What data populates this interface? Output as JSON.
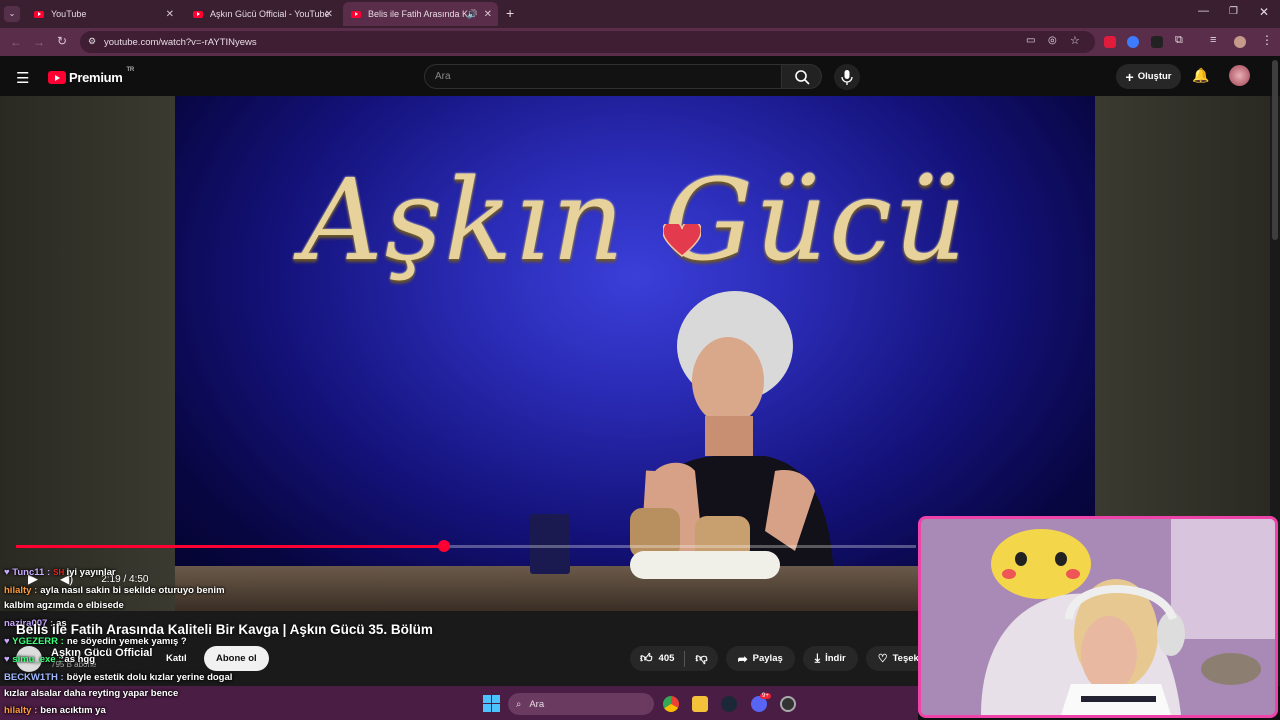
{
  "browser": {
    "tabs": [
      {
        "label": "YouTube"
      },
      {
        "label": "Aşkın Gücü Official - YouTube"
      },
      {
        "label": "Belis ile Fatih Arasında Kalit"
      }
    ],
    "url": "youtube.com/watch?v=-rAYTINyews"
  },
  "youtube": {
    "brand": "Premium",
    "region": "TR",
    "search_placeholder": "Ara",
    "create_label": "Oluştur"
  },
  "video": {
    "show_title": "Aşkın Gücü",
    "time": "2:19 / 4:50",
    "progress": 0.475,
    "title": "Belis ile Fatih Arasında Kaliteli Bir Kavga | Aşkın Gücü 35. Bölüm",
    "channel": "Aşkın Gücü Official",
    "subscribers": "795 B abone",
    "join_label": "Katıl",
    "subscribe_label": "Abone ol",
    "likes": "405",
    "share_label": "Paylaş",
    "download_label": "İndir",
    "thanks_label": "Teşekkür"
  },
  "chat": [
    {
      "user": "Tunc11 :",
      "text": "iyi yayınlar",
      "color": "#c9a8ff"
    },
    {
      "user": "hilalty :",
      "text": "ayla nasıl sakin bi sekilde oturuyo benim",
      "color": "#ff9a3d"
    },
    {
      "user": "",
      "text": "kalbim agzımda o elbisede",
      "color": "#ffffff"
    },
    {
      "user": "nazira007 :",
      "text": "as",
      "color": "#c9a8ff"
    },
    {
      "user": "YGEZERR :",
      "text": "ne söyedin yemek yamış ?",
      "color": "#3dff7a"
    },
    {
      "user": "simu_exe :",
      "text": "as hgg",
      "color": "#3dff7a"
    },
    {
      "user": "BECKW1TH :",
      "text": "böyle estetik dolu kızlar yerine dogal",
      "color": "#9fb8ff"
    },
    {
      "user": "",
      "text": "kızlar alsalar daha reyting yapar bence",
      "color": "#ffffff"
    },
    {
      "user": "hilalty :",
      "text": "ben acıktım ya",
      "color": "#ff9a3d"
    }
  ],
  "taskbar": {
    "search_placeholder": "Ara",
    "badge": "9+"
  }
}
